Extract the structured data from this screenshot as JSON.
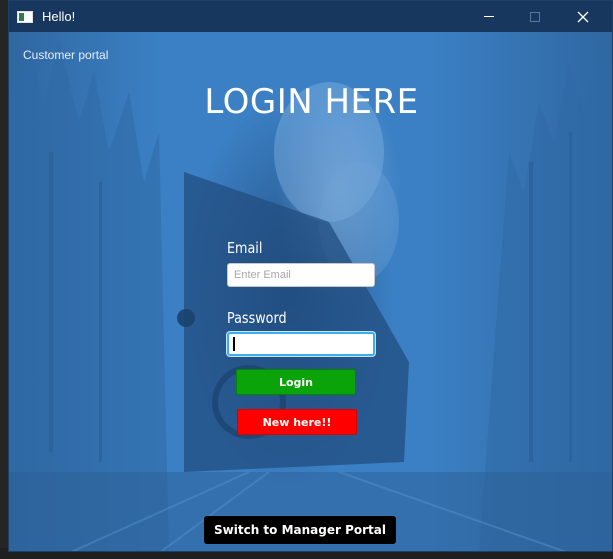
{
  "window": {
    "title": "Hello!"
  },
  "portal_label": "Customer portal",
  "heading": "LOGIN HERE",
  "email": {
    "label": "Email",
    "placeholder": "Enter Email",
    "value": ""
  },
  "password": {
    "label": "Password",
    "value": ""
  },
  "buttons": {
    "login": "Login",
    "new_here": "New here!!",
    "switch_portal": "Switch to Manager Portal"
  },
  "colors": {
    "titlebar": "#17375e",
    "background": "#3b80c4",
    "login_button": "#0aa30a",
    "new_button": "#ff0000",
    "switch_button": "#000000",
    "focus_ring": "#3daee9"
  },
  "icons": {
    "app": "app-window-icon",
    "minimize": "minimize-icon",
    "maximize": "maximize-icon",
    "close": "close-icon"
  }
}
